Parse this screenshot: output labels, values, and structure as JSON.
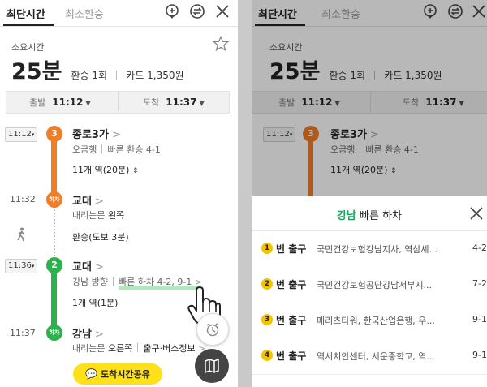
{
  "left": {
    "tabs": [
      "최단시간",
      "최소환승"
    ],
    "icons": [
      "location-pin-icon",
      "swap-icon",
      "close-icon"
    ],
    "summary_label": "소요시간",
    "duration": "25분",
    "transfer": "환승 1회",
    "fare": "카드 1,350원",
    "depart_label": "출발",
    "depart_time": "11:12",
    "arrive_label": "도착",
    "arrive_time": "11:37",
    "stops": [
      {
        "time": "11:12",
        "badge": "3",
        "name": "종로3가",
        "sub": "오금행",
        "sub2": "빠른 환승 4-1",
        "detail": "11개 역(20분)"
      },
      {
        "time": "11:32",
        "badge": "하차",
        "name": "교대",
        "sub": "내리는문",
        "sub_bold": "왼쪽"
      },
      {
        "walk": "환승(도보 3분)"
      },
      {
        "time": "11:36",
        "badge": "2",
        "name": "교대",
        "sub": "강남 방향",
        "sub2": "빠른 하차 4-2, 9-1",
        "detail": "1개 역(1분)"
      },
      {
        "time": "11:37",
        "badge": "하차",
        "name": "강남",
        "sub": "내리는문",
        "sub_bold": "오른쪽",
        "sub2": "출구·버스정보"
      }
    ],
    "share_button": "도착시간공유",
    "colors": {
      "line3": "#f07d28",
      "line2": "#2bb24c",
      "share": "#ffe11a"
    }
  },
  "right": {
    "tabs": [
      "최단시간",
      "최소환승"
    ],
    "duration": "25분",
    "transfer": "환승 1회",
    "fare": "카드 1,350원",
    "summary_label": "소요시간",
    "depart_label": "출발",
    "depart_time": "11:12",
    "arrive_label": "도착",
    "arrive_time": "11:37",
    "stop": {
      "time": "11:12",
      "badge": "3",
      "name": "종로3가",
      "sub": "오금행",
      "sub2": "빠른 환승 4-1",
      "detail": "11개 역(20분)"
    },
    "sheet_station": "강남",
    "sheet_title_rest": "빠른 하차",
    "exits": [
      {
        "num": "1",
        "label": "번 출구",
        "desc": "국민건강보험강남지사, 역삼세...",
        "platform": "4-2"
      },
      {
        "num": "2",
        "label": "번 출구",
        "desc": "국민건강보험공단강남서부지...",
        "platform": "7-2"
      },
      {
        "num": "3",
        "label": "번 출구",
        "desc": "메리츠타워, 한국산업은행, 우...",
        "platform": "9-1"
      },
      {
        "num": "4",
        "label": "번 출구",
        "desc": "역서치안센터, 서운중학교, 역...",
        "platform": "9-1"
      }
    ]
  }
}
